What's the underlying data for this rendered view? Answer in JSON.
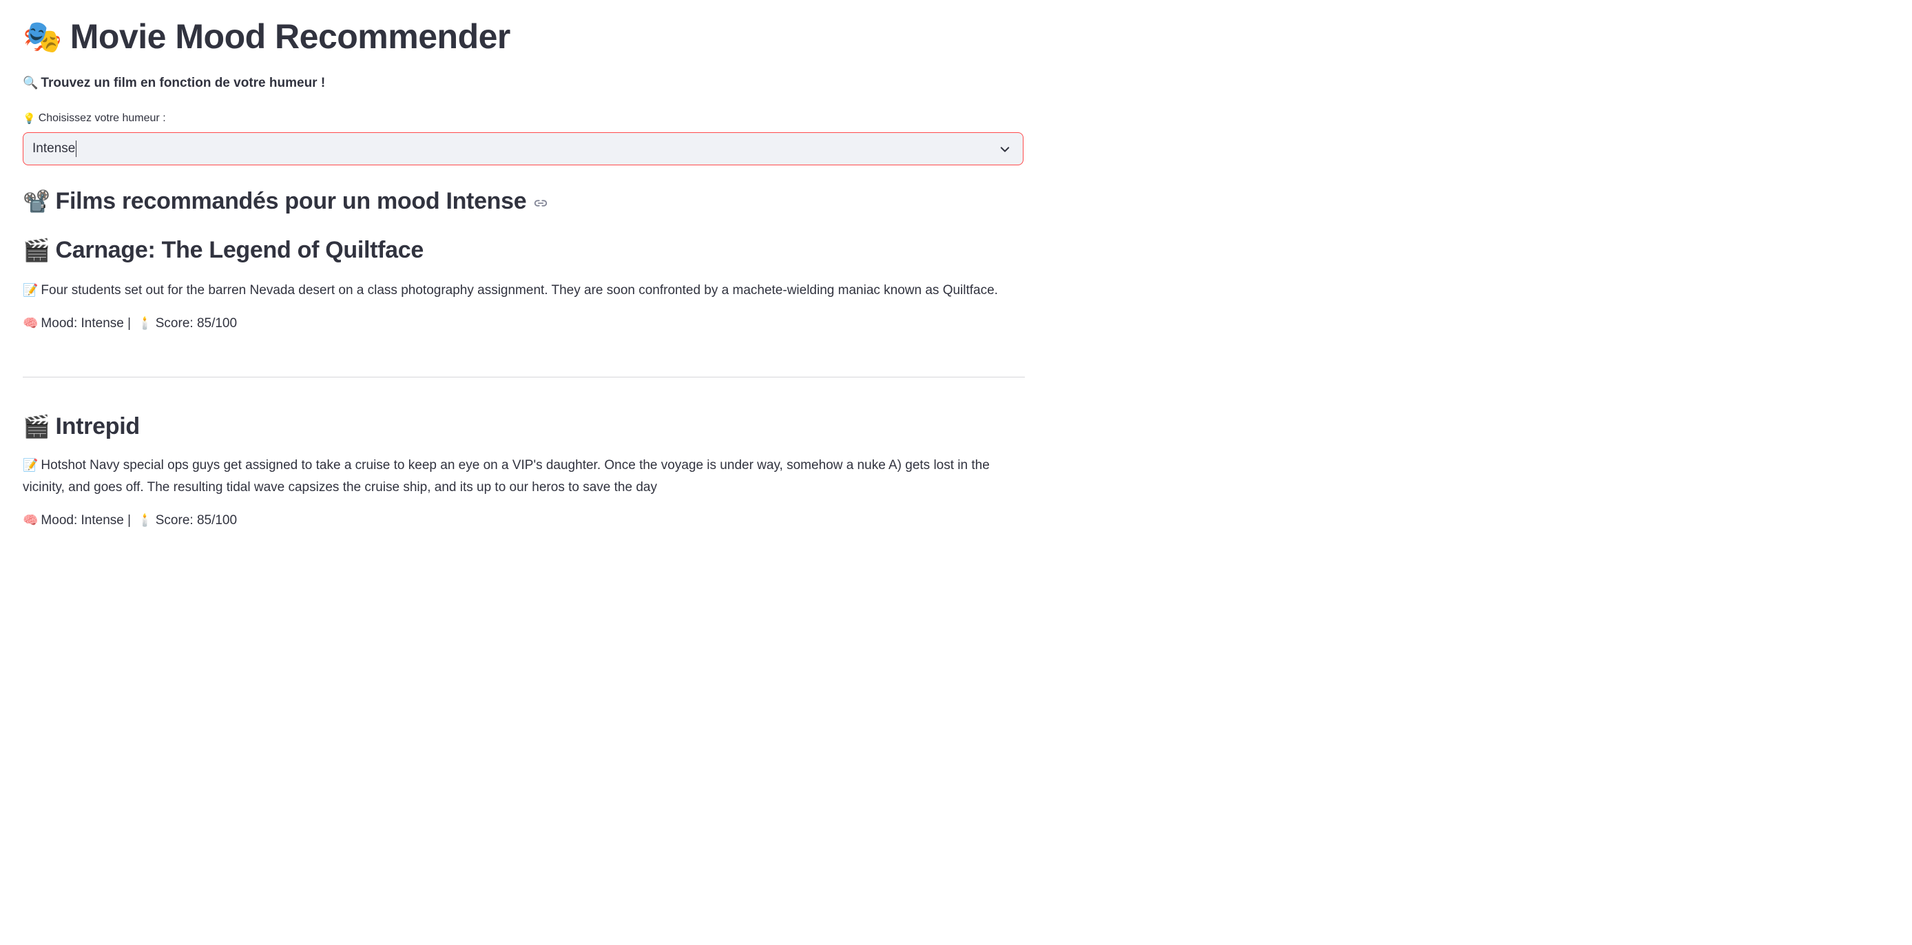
{
  "header": {
    "title_icon": "🎭",
    "title": "Movie Mood Recommender",
    "subtitle_icon": "🔍",
    "subtitle": "Trouvez un film en fonction de votre humeur !"
  },
  "mood_select": {
    "label_icon": "💡",
    "label": "Choisissez votre humeur :",
    "value": "Intense",
    "accent_color": "#ff4b4b"
  },
  "results": {
    "heading_icon": "📽️",
    "heading": "Films recommandés pour un mood Intense",
    "movies": [
      {
        "icon": "🎬",
        "title": "Carnage: The Legend of Quiltface",
        "desc_icon": "📝",
        "description": "Four students set out for the barren Nevada desert on a class photography assignment. They are soon confronted by a machete-wielding maniac known as Quiltface.",
        "mood_icon": "🧠",
        "meta": "Mood: Intense | ",
        "score_icon": "🕯️",
        "score": "Score: 85/100"
      },
      {
        "icon": "🎬",
        "title": "Intrepid",
        "desc_icon": "📝",
        "description": "Hotshot Navy special ops guys get assigned to take a cruise to keep an eye on a VIP's daughter. Once the voyage is under way, somehow a nuke A) gets lost in the vicinity, and goes off. The resulting tidal wave capsizes the cruise ship, and its up to our heros to save the day",
        "mood_icon": "🧠",
        "meta": "Mood: Intense | ",
        "score_icon": "🕯️",
        "score": "Score: 85/100"
      }
    ]
  }
}
